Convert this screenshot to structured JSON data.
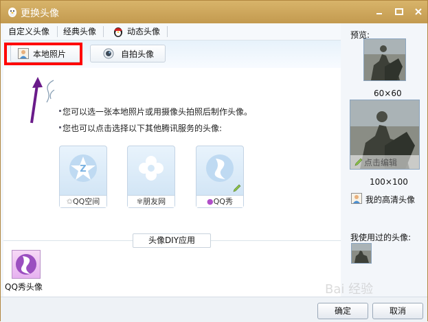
{
  "window": {
    "title": "更换头像",
    "buttons": [
      "minimize",
      "maximize",
      "close"
    ]
  },
  "tabs": [
    {
      "label": "自定义头像",
      "active": true
    },
    {
      "label": "经典头像",
      "active": false
    },
    {
      "label": "动态头像",
      "active": false
    }
  ],
  "toolbar": {
    "local_photo_label": "本地照片",
    "camera_label": "自拍头像"
  },
  "main": {
    "line1": "您可以选一张本地照片或用摄像头拍照后制作头像。",
    "line2": "您也可以点击选择以下其他腾讯服务的头像:",
    "services": [
      {
        "label": "QQ空间"
      },
      {
        "label": "朋友网"
      },
      {
        "label": "QQ秀"
      }
    ],
    "diy_label": "头像DIY应用",
    "qqshow_label": "QQ秀头像"
  },
  "preview": {
    "heading": "预览:",
    "size_small": "60×60",
    "size_large": "100×100",
    "edit_label": "点击编辑",
    "hd_label": "我的高清头像",
    "used_label": "我使用过的头像:"
  },
  "footer": {
    "ok_label": "确定",
    "cancel_label": "取消"
  },
  "watermark": "Bai 经验",
  "colors": {
    "titlebar": "#c9a257",
    "highlight": "#ff0000",
    "arrow": "#6a1b8a",
    "accent_blue": "#5a9ed8"
  }
}
